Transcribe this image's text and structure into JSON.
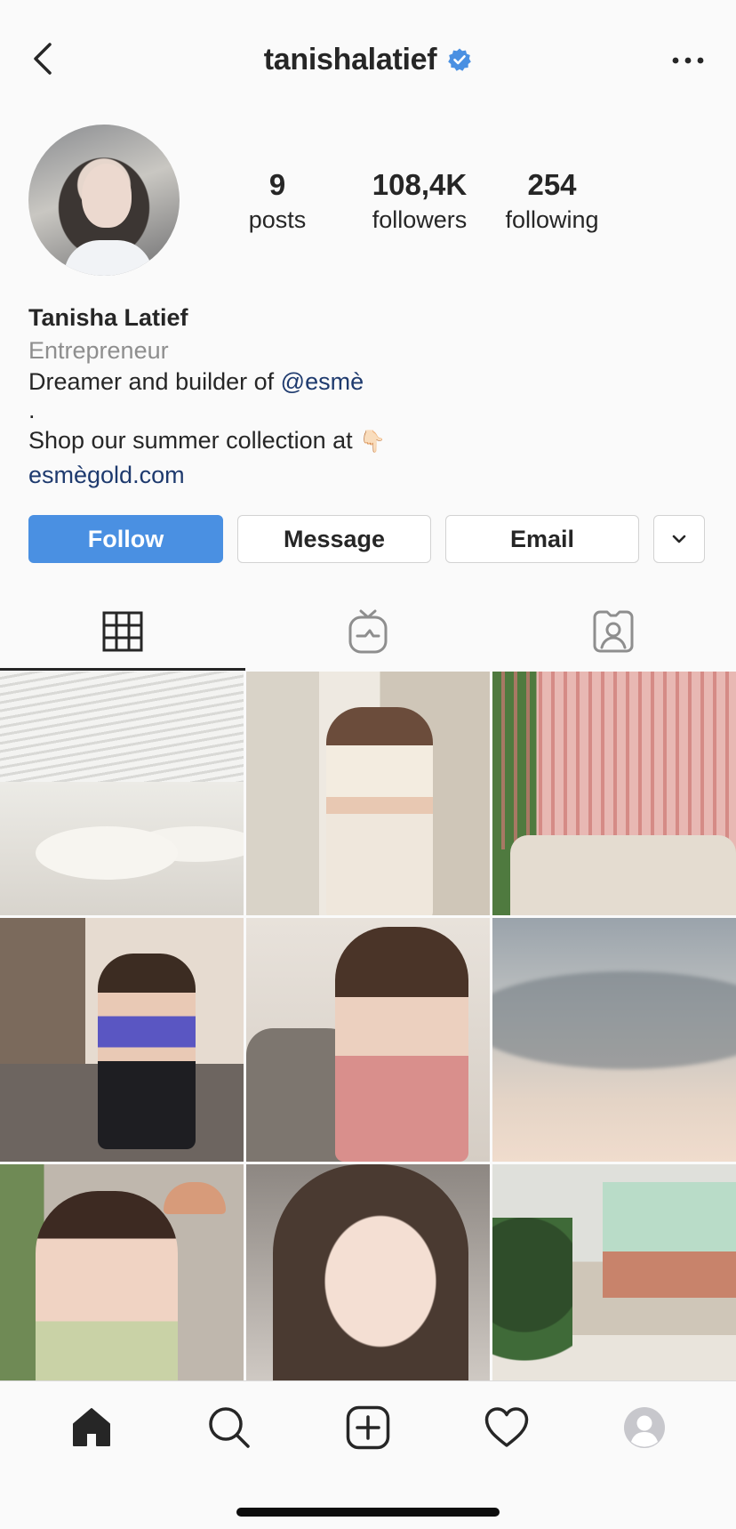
{
  "header": {
    "username": "tanishalatief",
    "verified": true,
    "back_icon": "chevron-left-icon",
    "more_icon": "more-horizontal-icon"
  },
  "profile": {
    "stats": [
      {
        "value": "9",
        "label": "posts"
      },
      {
        "value": "108,4K",
        "label": "followers"
      },
      {
        "value": "254",
        "label": "following"
      }
    ],
    "name": "Tanisha Latief",
    "category": "Entrepreneur",
    "bio_line1_text": "Dreamer and builder of ",
    "bio_line1_mention": "@esmè",
    "bio_line2": ".",
    "bio_line3": "Shop our summer collection at ",
    "bio_line3_emoji": "👇🏻",
    "website": "esmègold.com"
  },
  "buttons": {
    "follow": "Follow",
    "message": "Message",
    "email": "Email",
    "more_icon": "chevron-down-icon"
  },
  "tabs": [
    {
      "icon": "grid-icon",
      "active": true
    },
    {
      "icon": "igtv-icon",
      "active": false
    },
    {
      "icon": "tagged-icon",
      "active": false
    }
  ],
  "grid": {
    "post_count_visible": 9
  },
  "bottom_nav": {
    "items": [
      "home-icon",
      "search-icon",
      "new-post-icon",
      "activity-heart-icon",
      "profile-icon"
    ]
  },
  "colors": {
    "follow_blue": "#4a90e2",
    "verified_blue": "#4a90e2",
    "link_blue": "#1e3a6e",
    "secondary_gray": "#8e8e8e"
  }
}
